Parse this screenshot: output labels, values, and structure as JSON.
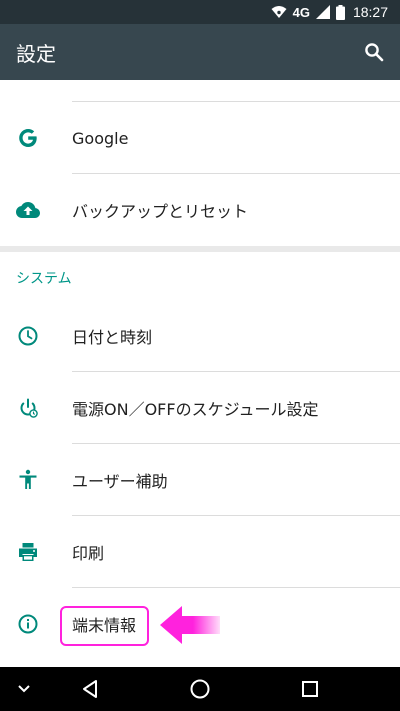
{
  "status_bar": {
    "network": "4G",
    "time": "18:27"
  },
  "app_bar": {
    "title": "設定",
    "search_icon": "search-icon"
  },
  "top_items": [
    {
      "label": "Google",
      "icon": "google-icon"
    },
    {
      "label": "バックアップとリセット",
      "icon": "cloud-upload-icon"
    }
  ],
  "system_section": {
    "header": "システム",
    "items": [
      {
        "label": "日付と時刻",
        "icon": "clock-icon"
      },
      {
        "label": "電源ON／OFFのスケジュール設定",
        "icon": "power-schedule-icon"
      },
      {
        "label": "ユーザー補助",
        "icon": "accessibility-icon"
      },
      {
        "label": "印刷",
        "icon": "print-icon"
      },
      {
        "label": "端末情報",
        "icon": "info-icon"
      }
    ]
  },
  "nav_bar": {
    "buttons": [
      "collapse-icon",
      "back-icon",
      "home-icon",
      "recents-icon"
    ]
  },
  "colors": {
    "status_bar": "#263238",
    "app_bar": "#37474f",
    "accent": "#009688",
    "highlight": "#ff22dd"
  }
}
